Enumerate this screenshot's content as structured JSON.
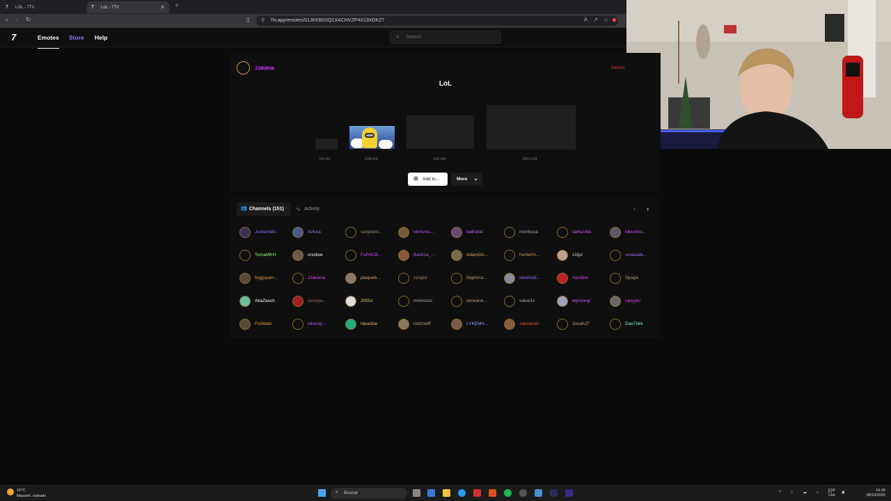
{
  "browser": {
    "tabs": [
      {
        "title": "LOL - 7TV",
        "active": false
      },
      {
        "title": "LoL - 7TV",
        "active": true
      }
    ],
    "new_tab": "+",
    "url": "7tv.app/emotes/01JKKB0XQ1XACHVZP4X13XDKZ7"
  },
  "site": {
    "logo": "7",
    "nav": {
      "emotes": "Emotes",
      "store": "Store",
      "help": "Help"
    },
    "search_placeholder": "Search"
  },
  "emote": {
    "owner": "JJakiena",
    "status": "Denied",
    "name": "LoL",
    "sizes": [
      "64×32",
      "128×64",
      "192×96",
      "256×128"
    ],
    "add_label": "Add to...",
    "more_label": "More"
  },
  "channels": {
    "tab_label": "Channels (151)",
    "activity_label": "Activity",
    "users": [
      {
        "name": "Jordanfeki",
        "color": "#9b6bff",
        "avatar": "#3a2f5a"
      },
      {
        "name": "Azfura",
        "color": "#8a7dff",
        "avatar": "#4a5a8a"
      },
      {
        "name": "sargeant...",
        "color": "#9a8a6a",
        "avatar": ""
      },
      {
        "name": "elimunis...",
        "color": "#b05cff",
        "avatar": "#7a5a3a"
      },
      {
        "name": "bathafar",
        "color": "#c060ff",
        "avatar": "#6a4a7a"
      },
      {
        "name": "monbuca",
        "color": "#aaa",
        "avatar": ""
      },
      {
        "name": "carla.IAIu",
        "color": "#e060ff",
        "avatar": ""
      },
      {
        "name": "bibushio...",
        "color": "#d050ff",
        "avatar": "#5a5a6a"
      },
      {
        "name": "TomaMKH",
        "color": "#9cff7a",
        "avatar": ""
      },
      {
        "name": "crxslive",
        "color": "#fff",
        "avatar": "#6a5a4a"
      },
      {
        "name": "FoPACill...",
        "color": "#d040ff",
        "avatar": ""
      },
      {
        "name": "Backsa_...",
        "color": "#b060e0",
        "avatar": "#8a5a3a"
      },
      {
        "name": "AdamGn...",
        "color": "#d8a860",
        "avatar": "#7a6a4a"
      },
      {
        "name": "hunterm...",
        "color": "#c8a060",
        "avatar": ""
      },
      {
        "name": "s1lpz",
        "color": "#ddd",
        "avatar": "#c0a090"
      },
      {
        "name": "ssnasafe...",
        "color": "#a070ff",
        "avatar": ""
      },
      {
        "name": "foggsparr...",
        "color": "#e0a040",
        "avatar": "#5a4a3a"
      },
      {
        "name": "JJakiena",
        "color": "#e040fb",
        "avatar": ""
      },
      {
        "name": "plaqueb...",
        "color": "#d8a860",
        "avatar": "#8a7a6a"
      },
      {
        "name": "zerqiol",
        "color": "#b08a60",
        "avatar": ""
      },
      {
        "name": "Nightma...",
        "color": "#c89a60",
        "avatar": ""
      },
      {
        "name": "sbmhold...",
        "color": "#a070ff",
        "avatar": "#8a8a9a"
      },
      {
        "name": "Yandice",
        "color": "#e040fb",
        "avatar": "#c02020"
      },
      {
        "name": "0pogix",
        "color": "#b0a080",
        "avatar": ""
      },
      {
        "name": "AkaZasch",
        "color": "#fff",
        "avatar": "#6ac0a0"
      },
      {
        "name": "oooopu...",
        "color": "#a07060",
        "avatar": "#a02020"
      },
      {
        "name": "2055z",
        "color": "#e0c060",
        "avatar": "#ddd"
      },
      {
        "name": "mixbosss",
        "color": "#aaa",
        "avatar": ""
      },
      {
        "name": "ionwann...",
        "color": "#c0a070",
        "avatar": ""
      },
      {
        "name": "value1x",
        "color": "#aaa",
        "avatar": ""
      },
      {
        "name": "wyvcong",
        "color": "#c060ff",
        "avatar": "#a0a0c0"
      },
      {
        "name": "nasyylu",
        "color": "#d050ff",
        "avatar": "#6a6a6a"
      },
      {
        "name": "Fishkido",
        "color": "#e0a030",
        "avatar": "#5a4a3a"
      },
      {
        "name": "elbangl...",
        "color": "#b050e0",
        "avatar": ""
      },
      {
        "name": "inpuulse",
        "color": "#e8c050",
        "avatar": "#20b080"
      },
      {
        "name": "lockzwtff",
        "color": "#b0a070",
        "avatar": "#8a7a5a"
      },
      {
        "name": "LYKEMA...",
        "color": "#80a0ff",
        "avatar": "#7a5a4a"
      },
      {
        "name": "zakwackk",
        "color": "#e05020",
        "avatar": "#8a5a3a"
      },
      {
        "name": "JonahJ7",
        "color": "#c0a070",
        "avatar": ""
      },
      {
        "name": "DaeTrikk",
        "color": "#80f0d0",
        "avatar": ""
      }
    ]
  },
  "taskbar": {
    "weather_temp": "16°C",
    "weather_desc": "Mayorm. soleado",
    "search_label": "Buscar",
    "lang_top": "ESP",
    "lang_bottom": "LAA",
    "time": "16:35",
    "date": "28/10/2025"
  }
}
